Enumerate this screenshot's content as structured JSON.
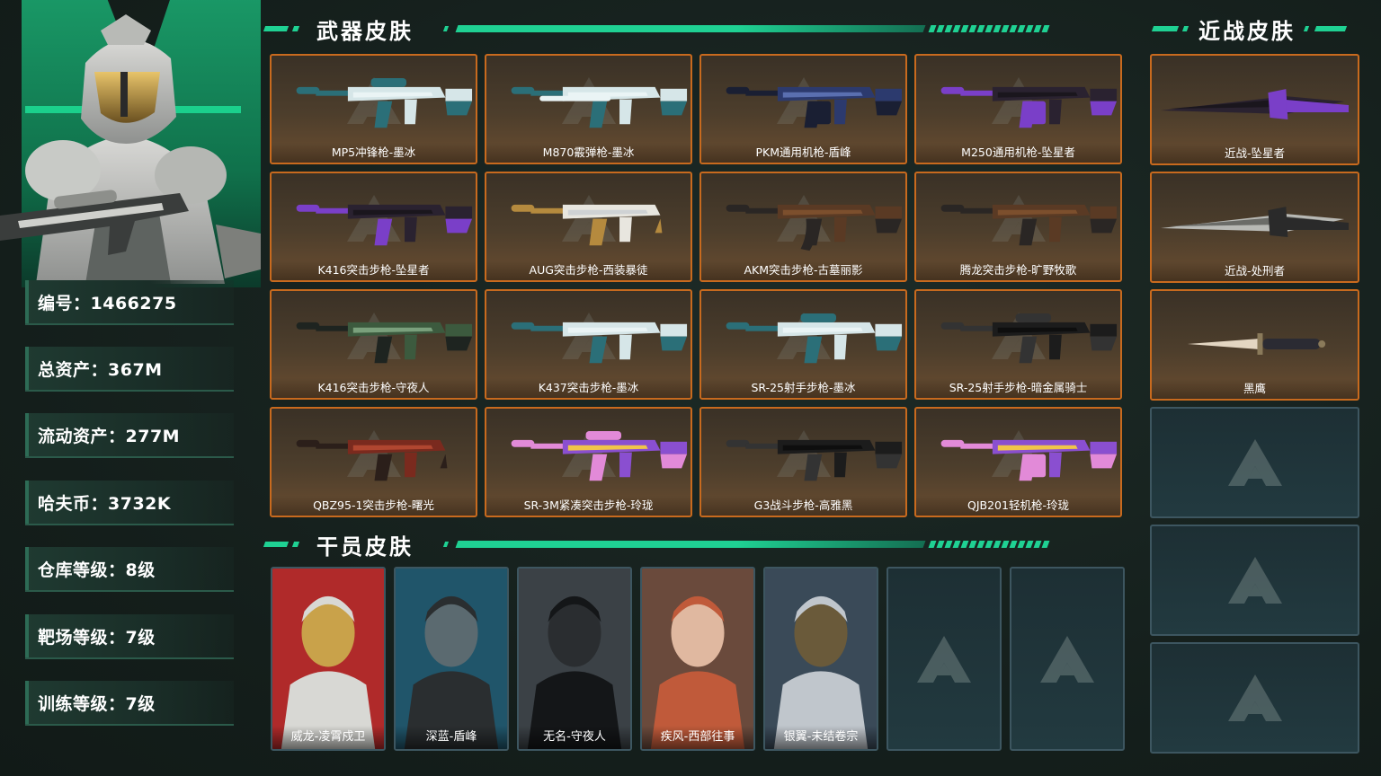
{
  "colors": {
    "accent": "#1fd193",
    "card_border": "#c86a1e",
    "empty_border": "#3d5660",
    "background": "#16221e"
  },
  "profile": {
    "stats": [
      {
        "name": "stat-id",
        "text": "编号：1466275"
      },
      {
        "name": "stat-total-assets",
        "text": "总资产：367M"
      },
      {
        "name": "stat-liquid-assets",
        "text": "流动资产：277M"
      },
      {
        "name": "stat-havcoin",
        "text": "哈夫币：3732K"
      },
      {
        "name": "stat-warehouse-level",
        "text": "仓库等级：8级"
      },
      {
        "name": "stat-range-level",
        "text": "靶场等级：7级"
      },
      {
        "name": "stat-training-level",
        "text": "训练等级：7级"
      }
    ]
  },
  "sections": {
    "weapons": "武器皮肤",
    "melee": "近战皮肤",
    "operators": "干员皮肤"
  },
  "weapons": [
    {
      "label": "MP5冲锋枪-墨冰",
      "icon": "smg-icon",
      "palette": "ice"
    },
    {
      "label": "M870霰弹枪-墨冰",
      "icon": "shotgun-icon",
      "palette": "ice"
    },
    {
      "label": "PKM通用机枪-盾峰",
      "icon": "lmg-icon",
      "palette": "navy"
    },
    {
      "label": "M250通用机枪-坠星者",
      "icon": "lmg-icon",
      "palette": "dark-purple"
    },
    {
      "label": "K416突击步枪-坠星者",
      "icon": "rifle-icon",
      "palette": "dark-purple"
    },
    {
      "label": "AUG突击步枪-西装暴徒",
      "icon": "bullpup-icon",
      "palette": "white-gold"
    },
    {
      "label": "AKM突击步枪-古墓丽影",
      "icon": "ak-icon",
      "palette": "wood"
    },
    {
      "label": "腾龙突击步枪-旷野牧歌",
      "icon": "rifle-icon",
      "palette": "wood"
    },
    {
      "label": "K416突击步枪-守夜人",
      "icon": "rifle-icon",
      "palette": "green"
    },
    {
      "label": "K437突击步枪-墨冰",
      "icon": "rifle-icon",
      "palette": "ice"
    },
    {
      "label": "SR-25射手步枪-墨冰",
      "icon": "dmr-icon",
      "palette": "ice"
    },
    {
      "label": "SR-25射手步枪-暗金属骑士",
      "icon": "dmr-icon",
      "palette": "black"
    },
    {
      "label": "QBZ95-1突击步枪-曙光",
      "icon": "bullpup-icon",
      "palette": "red"
    },
    {
      "label": "SR-3M紧凑突击步枪-玲珑",
      "icon": "smg-icon",
      "palette": "holo"
    },
    {
      "label": "G3战斗步枪-高雅黑",
      "icon": "rifle-icon",
      "palette": "black"
    },
    {
      "label": "QJB201轻机枪-玲珑",
      "icon": "lmg-icon",
      "palette": "holo"
    }
  ],
  "melee": [
    {
      "label": "近战-坠星者",
      "icon": "knife-icon",
      "palette": "dark-purple"
    },
    {
      "label": "近战-处刑者",
      "icon": "knife-icon",
      "palette": "steel"
    },
    {
      "label": "黑鹰",
      "icon": "dagger-icon",
      "palette": "bone"
    }
  ],
  "operators": [
    {
      "label": "威龙-凌霄戍卫",
      "icon": "operator-portrait-icon",
      "palette": "armor-white"
    },
    {
      "label": "深蓝-盾峰",
      "icon": "operator-portrait-icon",
      "palette": "armor-dark"
    },
    {
      "label": "无名-守夜人",
      "icon": "operator-portrait-icon",
      "palette": "mask-black"
    },
    {
      "label": "疾风-西部往事",
      "icon": "operator-portrait-icon",
      "palette": "red-hair"
    },
    {
      "label": "银翼-未结卷宗",
      "icon": "operator-portrait-icon",
      "palette": "silver-hair"
    }
  ]
}
